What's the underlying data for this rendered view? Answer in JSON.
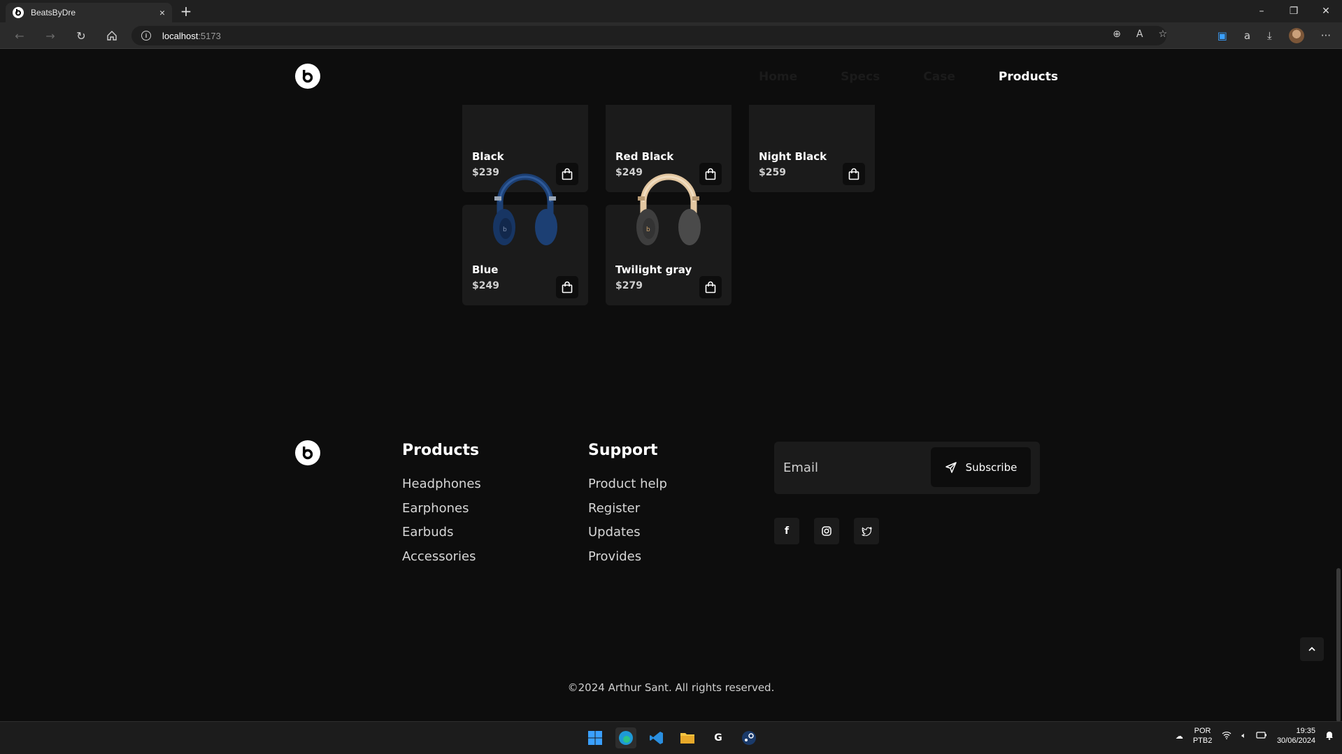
{
  "browser": {
    "tab_title": "BeatsByDre",
    "tab_close": "×",
    "new_tab": "+",
    "url_host": "localhost",
    "url_port": ":5173",
    "window_controls": [
      "–",
      "❐",
      "✕"
    ]
  },
  "nav": {
    "links": [
      "Home",
      "Specs",
      "Case",
      "Products"
    ],
    "active": "Products"
  },
  "products": [
    {
      "name": "Black",
      "price": "$239"
    },
    {
      "name": "Red Black",
      "price": "$249"
    },
    {
      "name": "Night Black",
      "price": "$259"
    },
    {
      "name": "Blue",
      "price": "$249",
      "color": "#1c3f73"
    },
    {
      "name": "Twilight gray",
      "price": "$279",
      "color": "#4a4a4a",
      "accent": "#e3c7a1"
    }
  ],
  "footer": {
    "products_title": "Products",
    "products_links": [
      "Headphones",
      "Earphones",
      "Earbuds",
      "Accessories"
    ],
    "support_title": "Support",
    "support_links": [
      "Product help",
      "Register",
      "Updates",
      "Provides"
    ],
    "email_placeholder": "Email",
    "subscribe_label": "Subscribe",
    "social": [
      "facebook",
      "instagram",
      "twitter"
    ],
    "copyright": "©2024 Arthur Sant. All rights reserved."
  },
  "taskbar": {
    "lang_top": "POR",
    "lang_bottom": "PTB2",
    "time": "19:35",
    "date": "30/06/2024"
  },
  "colors": {
    "background": "#0d0d0d",
    "card": "#1b1b1b",
    "nav_inactive": "#1b1b1b",
    "nav_active": "#ffffff"
  }
}
